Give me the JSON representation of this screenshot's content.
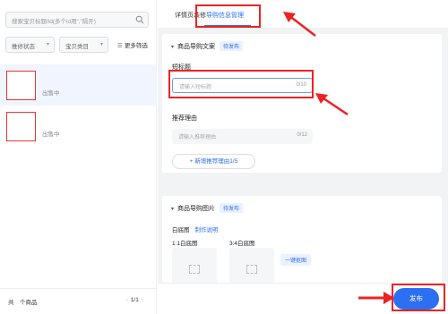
{
  "left_panel": {
    "search": {
      "placeholder": "搜索宝贝标题/id(多个id用“,”隔开)"
    },
    "filters": {
      "status_label": "推修状态",
      "category_label": "宝贝类目",
      "more_label": "更多筛选"
    },
    "items": [
      {
        "status": "出售中"
      },
      {
        "status": "出售中"
      }
    ],
    "footer": {
      "total": "共　个商品",
      "page": "1/1"
    }
  },
  "tabs": [
    {
      "label": "详情页装修",
      "active": false
    },
    {
      "label": "导购信息管理",
      "active": true
    }
  ],
  "section_copy": {
    "title": "商品导购文案",
    "tag": "待发布",
    "short_title": {
      "label": "短标题",
      "placeholder": "请输入短标题",
      "count": "0/10"
    },
    "reason": {
      "label": "推荐理由",
      "placeholder": "请输入推荐理由",
      "count": "0/12"
    },
    "add_reason": "+ 新增推荐理由1/5"
  },
  "section_images": {
    "title": "商品导购图片",
    "tag": "待发布",
    "white_bg_label": "白底图",
    "help_link": "制作说明",
    "slot_1_label": "1:1白底图",
    "slot_2_label": "3:4白底图",
    "onekey_label": "一键抠图"
  },
  "publish_button": "发布",
  "colors": {
    "accent": "#2b6ff2",
    "annotation": "#e22222"
  }
}
